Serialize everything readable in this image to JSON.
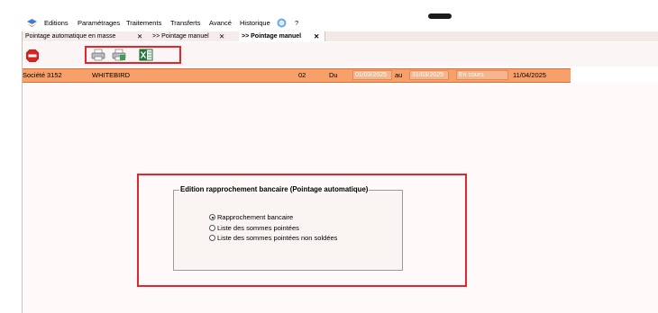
{
  "menubar": {
    "items": [
      "Editions",
      "Paramétrages",
      "Traitements",
      "Transferts",
      "Avancé",
      "Historique",
      "?"
    ]
  },
  "tabs": [
    {
      "label": "Pointage automatique en masse",
      "close": "✕"
    },
    {
      "label": ">> Pointage manuel",
      "close": "✕"
    },
    {
      "label": ">> Pointage manuel",
      "close": "✕"
    }
  ],
  "company_bar": {
    "societe_label": "Société",
    "societe_code": "3152",
    "societe_name": "WHITEBIRD",
    "period": "02",
    "du_label": "Du",
    "date_from": "01/03/2025",
    "au_label": "au",
    "date_to": "31/03/2025",
    "status": "En cours",
    "date_current": "11/04/2025"
  },
  "dialog": {
    "title": "Edition rapprochement bancaire (Pointage automatique)",
    "options": [
      {
        "label": "Rapprochement bancaire",
        "checked": true
      },
      {
        "label": "Liste des sommes pointées",
        "checked": false
      },
      {
        "label": "Liste des sommes pointées non soldées",
        "checked": false
      }
    ]
  },
  "colors": {
    "accent_orange": "#f8a06a",
    "highlight_red": "#e5242b"
  },
  "icons": [
    "app-logo-icon",
    "help-icon",
    "stop-icon",
    "printer-icon",
    "export-printer-icon",
    "excel-icon"
  ]
}
